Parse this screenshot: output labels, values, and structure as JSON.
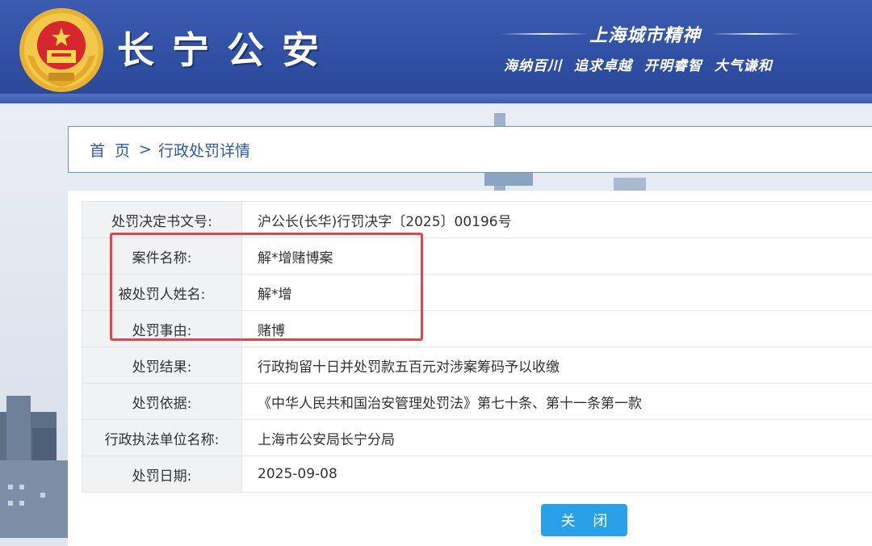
{
  "header": {
    "site_title": "长宁公安",
    "slogan_title": "上海城市精神",
    "slogan_sub": "海纳百川 追求卓越 开明睿智 大气谦和",
    "emblem_icon": "police-emblem-icon"
  },
  "breadcrumb": {
    "home": "首 页",
    "separator": ">",
    "current": "行政处罚详情"
  },
  "details": {
    "rows": [
      {
        "label": "处罚决定书文号:",
        "value": "沪公长(长华)行罚决字〔2025〕00196号"
      },
      {
        "label": "案件名称:",
        "value": "解*增赌博案"
      },
      {
        "label": "被处罚人姓名:",
        "value": "解*增"
      },
      {
        "label": "处罚事由:",
        "value": "赌博"
      },
      {
        "label": "处罚结果:",
        "value": "行政拘留十日并处罚款五百元对涉案筹码予以收缴"
      },
      {
        "label": "处罚依据:",
        "value": "《中华人民共和国治安管理处罚法》第七十条、第十一条第一款"
      },
      {
        "label": "行政执法单位名称:",
        "value": "上海市公安局长宁分局"
      },
      {
        "label": "处罚日期:",
        "value": "2025-09-08"
      }
    ]
  },
  "actions": {
    "close_label": "关 闭"
  },
  "colors": {
    "header_blue": "#2f4fa3",
    "link_blue": "#2f58a4",
    "button_blue": "#2aa0e8",
    "highlight_red": "#e8424b"
  }
}
